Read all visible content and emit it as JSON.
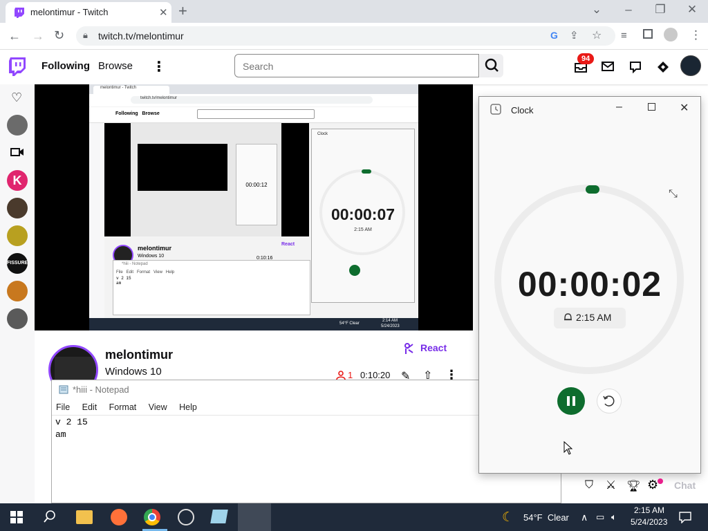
{
  "browser": {
    "tab_title": "melontimur - Twitch",
    "url": "twitch.tv/melontimur"
  },
  "twitch": {
    "nav": {
      "following": "Following",
      "browse": "Browse"
    },
    "search_placeholder": "Search",
    "notification_count": "94",
    "sidebar_avatars": [
      {
        "letter": "",
        "color": "#6b6b6b"
      },
      {
        "letter": "K",
        "color": "#e0256e"
      },
      {
        "letter": "",
        "color": "#4a3a2c"
      },
      {
        "letter": "",
        "color": "#b8a020"
      },
      {
        "letter": "FISSURE",
        "color": "#111111"
      },
      {
        "letter": "",
        "color": "#c8781e"
      },
      {
        "letter": "",
        "color": "#5a5a5a"
      }
    ],
    "channel": {
      "name": "melontimur",
      "title": "Windows 10",
      "react_label": "React",
      "viewers": "1",
      "uptime": "0:10:20"
    },
    "chat_label": "Chat"
  },
  "embedded_stream": {
    "tab_title": "melontimur - Twitch",
    "url": "twitch.tv/melontimur",
    "nested_timer": "00:00:12",
    "timer": "00:00:07",
    "alarm": "2:15 AM",
    "channel": "melontimur",
    "stream_title": "Windows 10",
    "viewers": "1",
    "uptime": "0:10:16",
    "react": "React",
    "notepad_title": "*hiii - Notepad",
    "notepad_menu": [
      "File",
      "Edit",
      "Format",
      "View",
      "Help"
    ],
    "notepad_text": "v 2 15\nam",
    "weather": "54°F  Clear",
    "time": "2:14 AM",
    "date": "5/24/2023"
  },
  "notepad": {
    "title": "*hiii - Notepad",
    "menu": [
      "File",
      "Edit",
      "Format",
      "View",
      "Help"
    ],
    "text": "v 2 15\nam"
  },
  "clock": {
    "title": "Clock",
    "timer": "00:00:02",
    "alarm_time": "2:15 AM"
  },
  "taskbar": {
    "weather": "54°F  Clear",
    "time": "2:15 AM",
    "date": "5/24/2023"
  },
  "colors": {
    "twitch_purple": "#9147ff",
    "clock_green": "#0e6d2e",
    "notification_red": "#e91916"
  }
}
